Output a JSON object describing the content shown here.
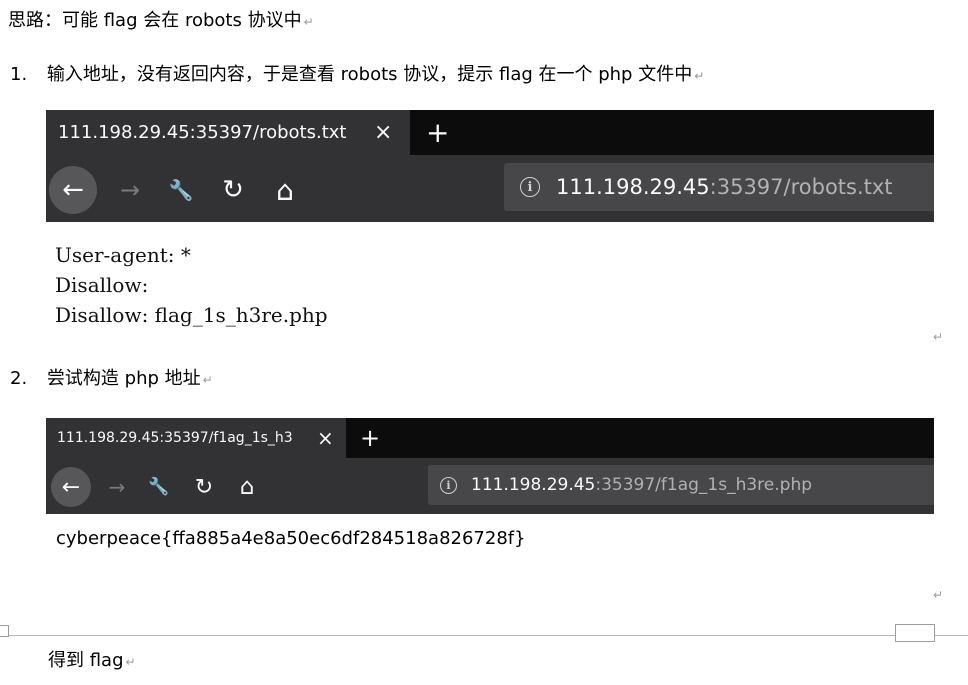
{
  "doc": {
    "intro": "思路：可能 flag 会在 robots 协议中",
    "step1_num": "1.",
    "step1_text": "输入地址，没有返回内容，于是查看 robots 协议，提示 flag 在一个 php 文件中",
    "step2_num": "2.",
    "step2_text": "尝试构造 php 地址",
    "conclusion": "得到 flag",
    "para_mark": "↵"
  },
  "browser1": {
    "tab_title": "111.198.29.45:35397/robots.txt",
    "close_glyph": "×",
    "new_tab_glyph": "+",
    "back_glyph": "←",
    "forward_glyph": "→",
    "tools_glyph": "🔧",
    "reload_glyph": "↻",
    "home_glyph": "⌂",
    "info_glyph": "i",
    "url_host": "111.198.29.45",
    "url_rest": ":35397/robots.txt"
  },
  "robots_lines": [
    "User-agent: *",
    "Disallow:",
    "Disallow: flag_1s_h3re.php"
  ],
  "browser2": {
    "tab_title": "111.198.29.45:35397/f1ag_1s_h3",
    "close_glyph": "×",
    "new_tab_glyph": "+",
    "back_glyph": "←",
    "forward_glyph": "→",
    "tools_glyph": "🔧",
    "reload_glyph": "↻",
    "home_glyph": "⌂",
    "info_glyph": "i",
    "url_host": "111.198.29.45",
    "url_rest": ":35397/f1ag_1s_h3re.php"
  },
  "flag_result": "cyberpeace{ffa885a4e8a50ec6df284518a826728f}",
  "icons": [
    "back-arrow-icon",
    "forward-arrow-icon",
    "wrench-icon",
    "reload-icon",
    "home-icon",
    "info-icon",
    "close-icon",
    "plus-icon"
  ],
  "colors": {
    "tabbar_bg": "#0c0c0d",
    "toolbar_bg": "#323234",
    "urlbar_bg": "#474749",
    "url_host": "#f9f9fa",
    "url_rest": "#b1b1b3"
  }
}
